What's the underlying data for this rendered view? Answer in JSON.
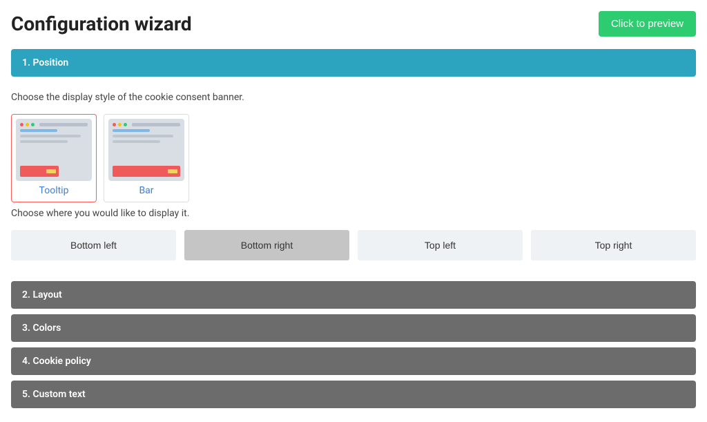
{
  "title": "Configuration wizard",
  "preview_button": "Click to preview",
  "steps": {
    "position": {
      "num": "1",
      "label": "Position"
    },
    "layout": {
      "num": "2",
      "label": "Layout"
    },
    "colors": {
      "num": "3",
      "label": "Colors"
    },
    "cookie": {
      "num": "4",
      "label": "Cookie policy"
    },
    "custom": {
      "num": "5",
      "label": "Custom text"
    }
  },
  "position_panel": {
    "style_instruction": "Choose the display style of the cookie consent banner.",
    "styles": {
      "tooltip": {
        "label": "Tooltip",
        "selected": true
      },
      "bar": {
        "label": "Bar",
        "selected": false
      }
    },
    "placement_instruction": "Choose where you would like to display it.",
    "placements": {
      "bottom_left": {
        "label": "Bottom left",
        "selected": false
      },
      "bottom_right": {
        "label": "Bottom right",
        "selected": true
      },
      "top_left": {
        "label": "Top left",
        "selected": false
      },
      "top_right": {
        "label": "Top right",
        "selected": false
      }
    }
  },
  "colors": {
    "accent": "#2ca4bf",
    "success": "#2ecc71",
    "danger_border": "#ff5b5b",
    "muted_panel": "#6c6c6c"
  }
}
